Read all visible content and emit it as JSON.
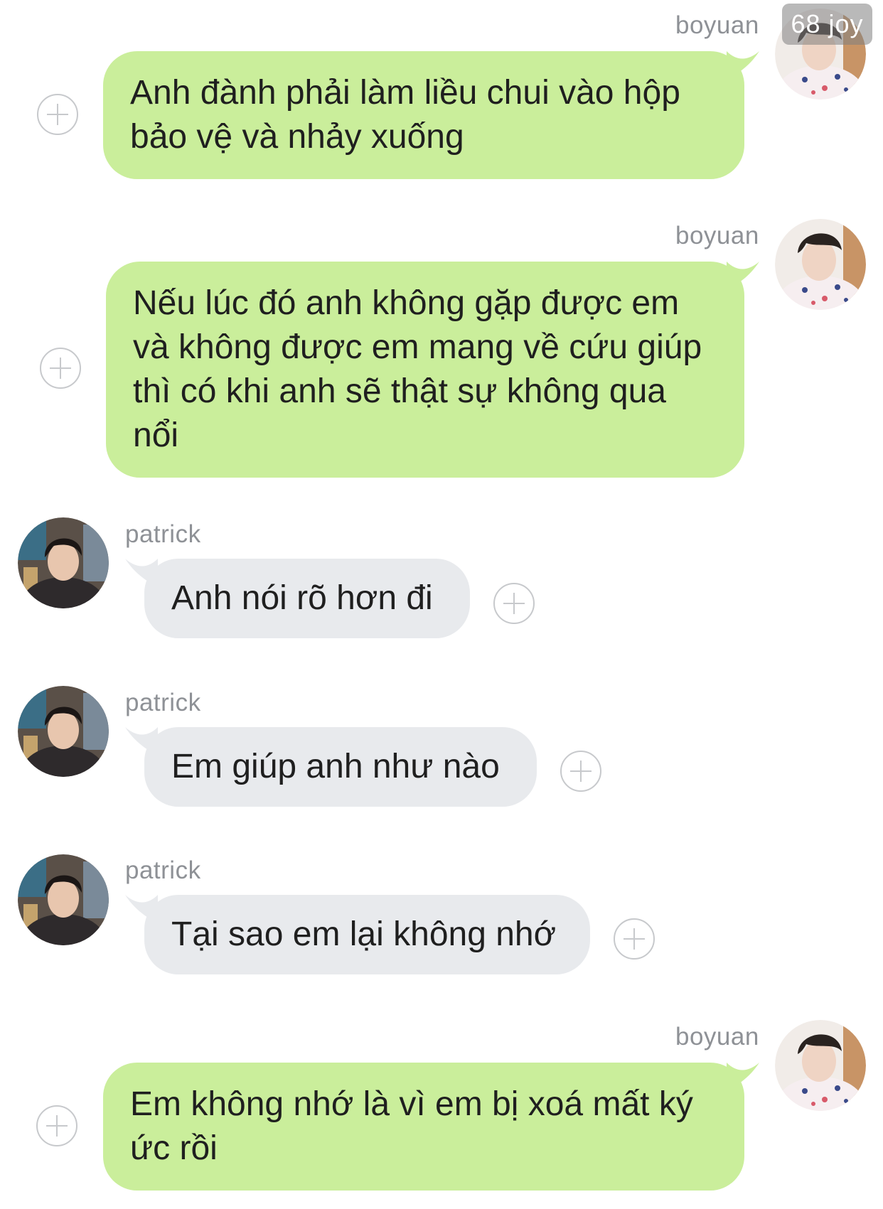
{
  "watermark": "68 joy",
  "icons": {
    "add_icon": "plus-circle-icon",
    "avatar_boyuan": "avatar-boyuan",
    "avatar_patrick": "avatar-patrick"
  },
  "colors": {
    "sent_bubble": "#caee9b",
    "received_bubble": "#e8eaed",
    "name_text": "#8e9196",
    "message_text": "#1f1f1f"
  },
  "messages": [
    {
      "sender": "boyuan",
      "direction": "sent",
      "text": "Anh đành phải làm liều chui vào hộp bảo vệ và nhảy xuống"
    },
    {
      "sender": "boyuan",
      "direction": "sent",
      "text": "Nếu lúc đó anh không gặp được em và không được em mang về cứu giúp thì có khi anh sẽ thật sự không qua nổi"
    },
    {
      "sender": "patrick",
      "direction": "received",
      "text": "Anh nói rõ hơn đi"
    },
    {
      "sender": "patrick",
      "direction": "received",
      "text": "Em giúp anh như nào"
    },
    {
      "sender": "patrick",
      "direction": "received",
      "text": "Tại sao em lại không nhớ"
    },
    {
      "sender": "boyuan",
      "direction": "sent",
      "text": "Em không nhớ là vì em bị xoá mất ký ức rồi"
    }
  ]
}
